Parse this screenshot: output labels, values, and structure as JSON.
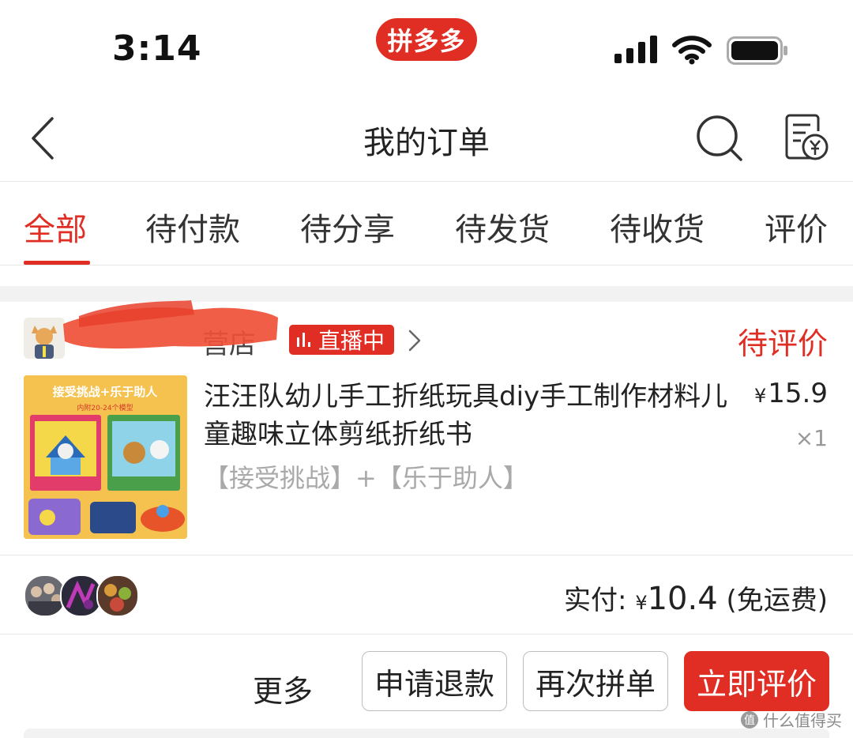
{
  "status_bar": {
    "time": "3:14",
    "app_badge": "拼多多"
  },
  "nav": {
    "title": "我的订单"
  },
  "tabs": [
    {
      "label": "全部",
      "active": true
    },
    {
      "label": "待付款"
    },
    {
      "label": "待分享"
    },
    {
      "label": "待发货"
    },
    {
      "label": "待收货"
    },
    {
      "label": "评价"
    }
  ],
  "order": {
    "shop_name_visible": "营店",
    "live_badge": "直播中",
    "status": "待评价",
    "product": {
      "title": "汪汪队幼儿手工折纸玩具diy手工制作材料儿童趣味立体剪纸折纸书",
      "spec": "【接受挑战】+【乐于助人】",
      "currency": "¥",
      "price": "15.9",
      "quantity": "×1",
      "thumb_banner": "接受挑战+乐于助人",
      "thumb_sub": "内附20-24个模型"
    },
    "payment": {
      "label": "实付:",
      "currency": "¥",
      "amount": "10.4",
      "note": "(免运费)"
    },
    "actions": {
      "more": "更多",
      "refund": "申请退款",
      "reorder": "再次拼单",
      "review": "立即评价"
    }
  },
  "watermark": "什么值得买",
  "colors": {
    "brand_red": "#e02e24",
    "muted_gray": "#a9a9a9"
  }
}
